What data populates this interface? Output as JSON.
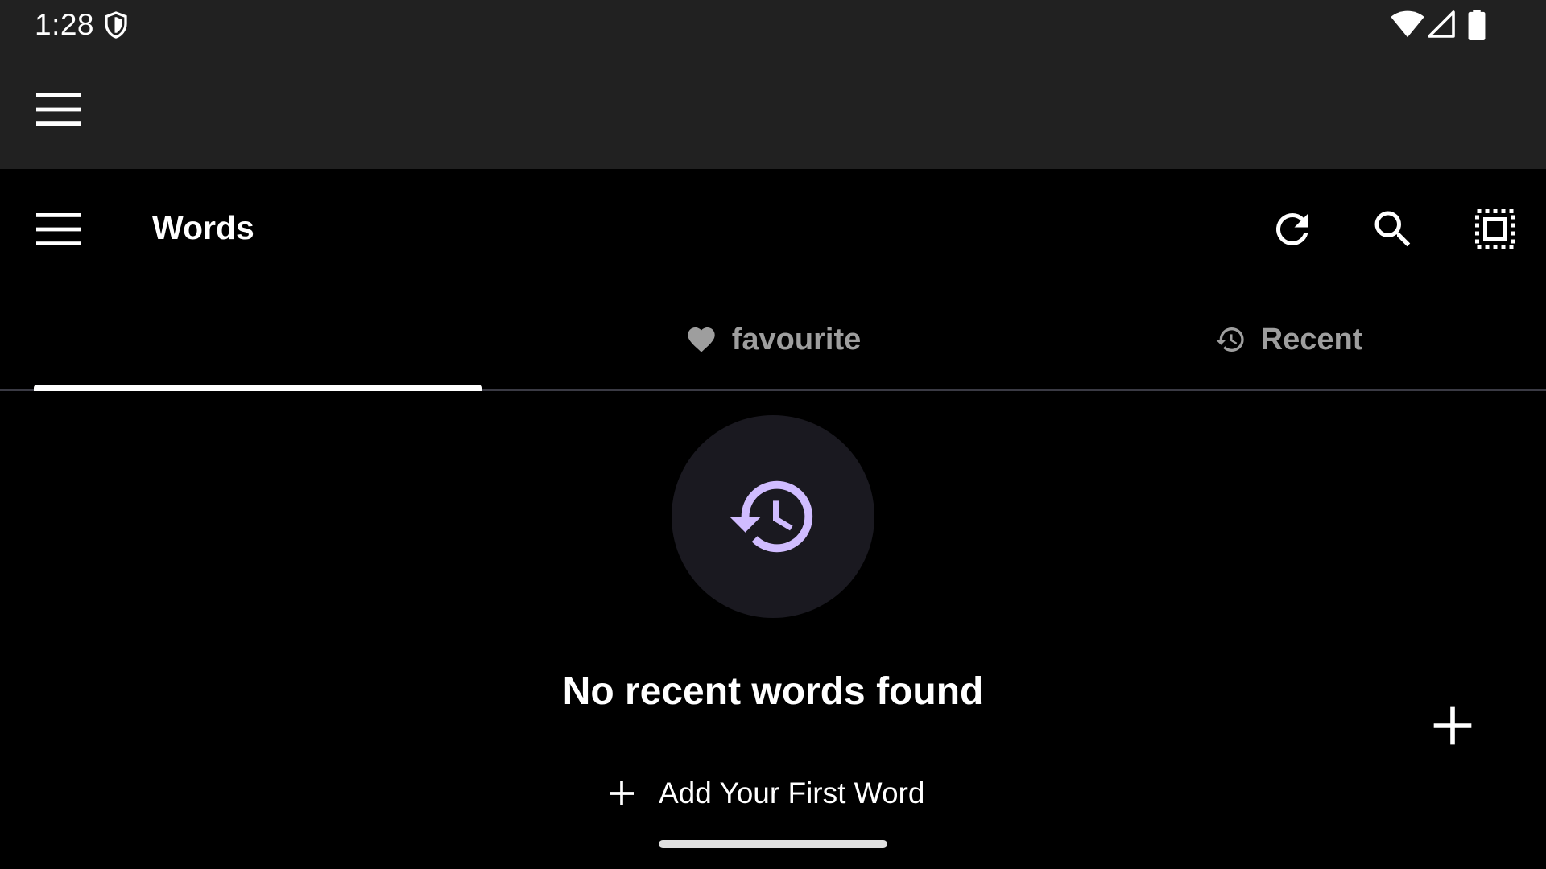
{
  "status_bar": {
    "time": "1:28",
    "icons": [
      "shield-icon",
      "wifi-icon",
      "cellular-signal-icon",
      "battery-icon"
    ]
  },
  "outer_bar": {
    "menu_icon": "hamburger-menu-icon"
  },
  "toolbar": {
    "title": "Words",
    "actions": [
      "refresh-icon",
      "search-icon",
      "select-all-icon"
    ]
  },
  "tabs": [
    {
      "label": "",
      "icon": "",
      "selected": true
    },
    {
      "label": "favourite",
      "icon": "heart-icon",
      "selected": false
    },
    {
      "label": "Recent",
      "icon": "history-icon",
      "selected": false
    }
  ],
  "empty_state": {
    "icon": "history-icon",
    "message": "No recent words found",
    "action_label": "Add Your First Word"
  },
  "fab": {
    "icon": "plus-icon"
  },
  "colors": {
    "bar_background": "#212121",
    "page_background": "#000000",
    "accent": "#d0bcff",
    "tab_inactive": "#9e9e9e",
    "empty_circle": "#1a1920"
  }
}
